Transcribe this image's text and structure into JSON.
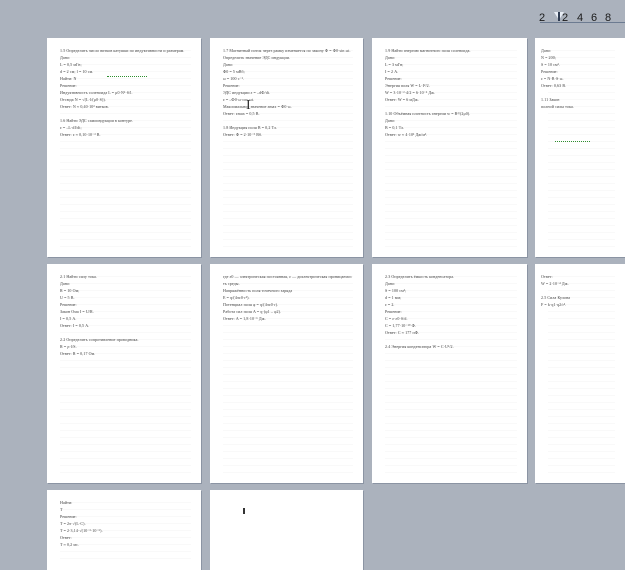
{
  "viewer": {
    "zoom_options": [
      "2",
      "2",
      "4",
      "6",
      "8"
    ]
  },
  "pages": [
    {
      "text": "1.5 Определить число витков катушки по индуктивности и размерам.\nДано:\nL = 0,5 мГн;\nd = 2 см; l = 10 см.\nНайти: N\nРешение:\nИндуктивность соленоида L = μ0·N²·S/l.\nОтсюда N = √(L·l/(μ0·S)).\nОтвет: N ≈ 0,40·10³ витков.\n\n1.6 Найти ЭДС самоиндукции в контуре.\nε = –L·dI/dt;\nОтвет: ε ≈ 0,10·10⁻³ В."
    },
    {
      "text": "1.7 Магнитный поток через рамку изменяется по закону Ф = Ф0·sin ωt. Определить значение ЭДС индукции.\nДано:\nФ0 = 5 мВб;\nω = 100 с⁻¹.\nРешение:\nЭДС индукции ε = –dФ/dt.\nε = –Ф0·ω·cos ωt.\nМаксимальное значение εmax = Ф0·ω.\nОтвет: εmax = 0,5 В.\n\n1.8 Индукция поля B = 0,2 Тл.\nОтвет: Ф = 2·10⁻⁵ Вб."
    },
    {
      "text": "1.9 Найти энергию магнитного поля соленоида.\nДано:\nL = 3 мГн;\nI = 2 А.\nРешение:\nЭнергия поля W = L·I²/2.\nW = 3·10⁻³·4/2 = 6·10⁻³ Дж.\nОтвет: W = 6 мДж.\n\n1.10 Объёмная плотность энергии w = B²/(2μ0).\nДано:\nB = 0,1 Тл.\nОтвет: w ≈ 4·10³ Дж/м³."
    },
    {
      "text": "Дано:\nN = 200;\nS = 10 см².\nРешение:\nε = N·B·S·ω.\nОтвет: 0,63 В.\n\n1.11 Закон\nполной силы тока."
    },
    {
      "text": "2.1 Найти силу тока.\nДано:\nR = 10 Ом;\nU = 5 В.\nРешение:\nЗакон Ома I = U/R.\nI = 0,5 А.\nОтвет: I = 0,5 А.\n\n2.2 Определить сопротивление проводника.\nR = ρ·l/S.\nОтвет: R = 0,17 Ом."
    },
    {
      "text": "где ε0 — электрическая постоянная, ε — диэлектрическая проницаемость среды.\nНапряжённость поля точечного заряда\nE = q/(4πε0·r²).\nПотенциал поля φ = q/(4πε0·r).\nРабота сил поля A = q·(φ1 – φ2).\nОтвет: A = 1,8·10⁻⁶ Дж."
    },
    {
      "text": "2.3 Определить ёмкость конденсатора.\nДано:\nS = 100 см²;\nd = 1 мм;\nε = 2.\nРешение:\nC = ε·ε0·S/d.\nC = 1,77·10⁻¹⁰ Ф.\nОтвет: C ≈ 177 пФ.\n\n2.4 Энергия конденсатора W = C·U²/2."
    },
    {
      "text": "Ответ:\nW = 2·10⁻⁴ Дж.\n\n2.5 Сила Кулона\nF = k·q1·q2/r²."
    },
    {
      "text": "Найти:\nT\nРешение:\nT = 2π·√(L·C).\nT = 2·3,14·√(10⁻³·10⁻⁶).\nОтвет:\nT ≈ 0,2 мс."
    },
    {
      "text": ""
    }
  ]
}
